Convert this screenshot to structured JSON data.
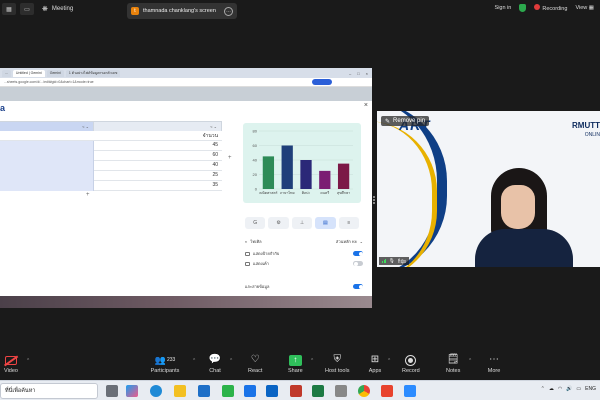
{
  "topbar": {
    "meeting_label": "Meeting",
    "share_avatar_letter": "t",
    "share_label": "thamnada chanklang's screen",
    "signin_label": "Sign in",
    "recording_label": "Recording",
    "view_label": "View"
  },
  "browser": {
    "tabs": [
      "...",
      "Untitled | Gemini",
      "Gemini",
      "1 ตัวอย่างไฟล์ข้อมูลกรอกตัวเลข"
    ],
    "address": "...sheets.google.com/d/.../edit#gid=0&chart=1&mode=true"
  },
  "dialog": {
    "title_letter": "a",
    "close_icon": "×",
    "column_headers": [
      "",
      "B",
      "C"
    ],
    "header_suffix": [
      "<",
      "<"
    ],
    "row_header": "จำนวน",
    "values": [
      "45",
      "60",
      "40",
      "25",
      "35"
    ],
    "add_symbol": "+"
  },
  "chart_data": {
    "type": "bar",
    "categories": [
      "คณิตศาสตร์",
      "ภาษาไทย",
      "ศิลปะ",
      "ดนตรี",
      "สุขศึกษา"
    ],
    "values": [
      45,
      60,
      40,
      25,
      35
    ],
    "ylim": [
      0,
      80
    ],
    "yticks": [
      0,
      20,
      40,
      60,
      80
    ],
    "colors": [
      "#2e8b57",
      "#1f3f7a",
      "#2b2878",
      "#7b1e73",
      "#7c1947"
    ],
    "background": "#ddf3ee"
  },
  "panel": {
    "tool_icons": [
      "G",
      "⚙",
      "⊥",
      "▤",
      "≡"
    ],
    "type_label": "ไทเทิล",
    "type_value": "ส่วนหลัก Kit",
    "toggle1_label": "แสดงป้ายกำกับ",
    "toggle2_label": "แสดงเค้า",
    "toggle3_label": "แกะสายข้อมูล"
  },
  "tile": {
    "logo_text": "ART",
    "brand": "RMUTT",
    "brand_sub": "ONLIN",
    "pin_label": "Remove pin",
    "name_label": "ก็ปุ๋ย"
  },
  "toolbar": {
    "video": "Video",
    "participants": "Participants",
    "participants_count": "233",
    "chat": "Chat",
    "react": "React",
    "share": "Share",
    "host_tools": "Host tools",
    "apps": "Apps",
    "record": "Record",
    "notes": "Notes",
    "more": "More"
  },
  "taskbar": {
    "search_text": "ที่นี่เพื่อค้นหา",
    "lang": "ENG"
  }
}
